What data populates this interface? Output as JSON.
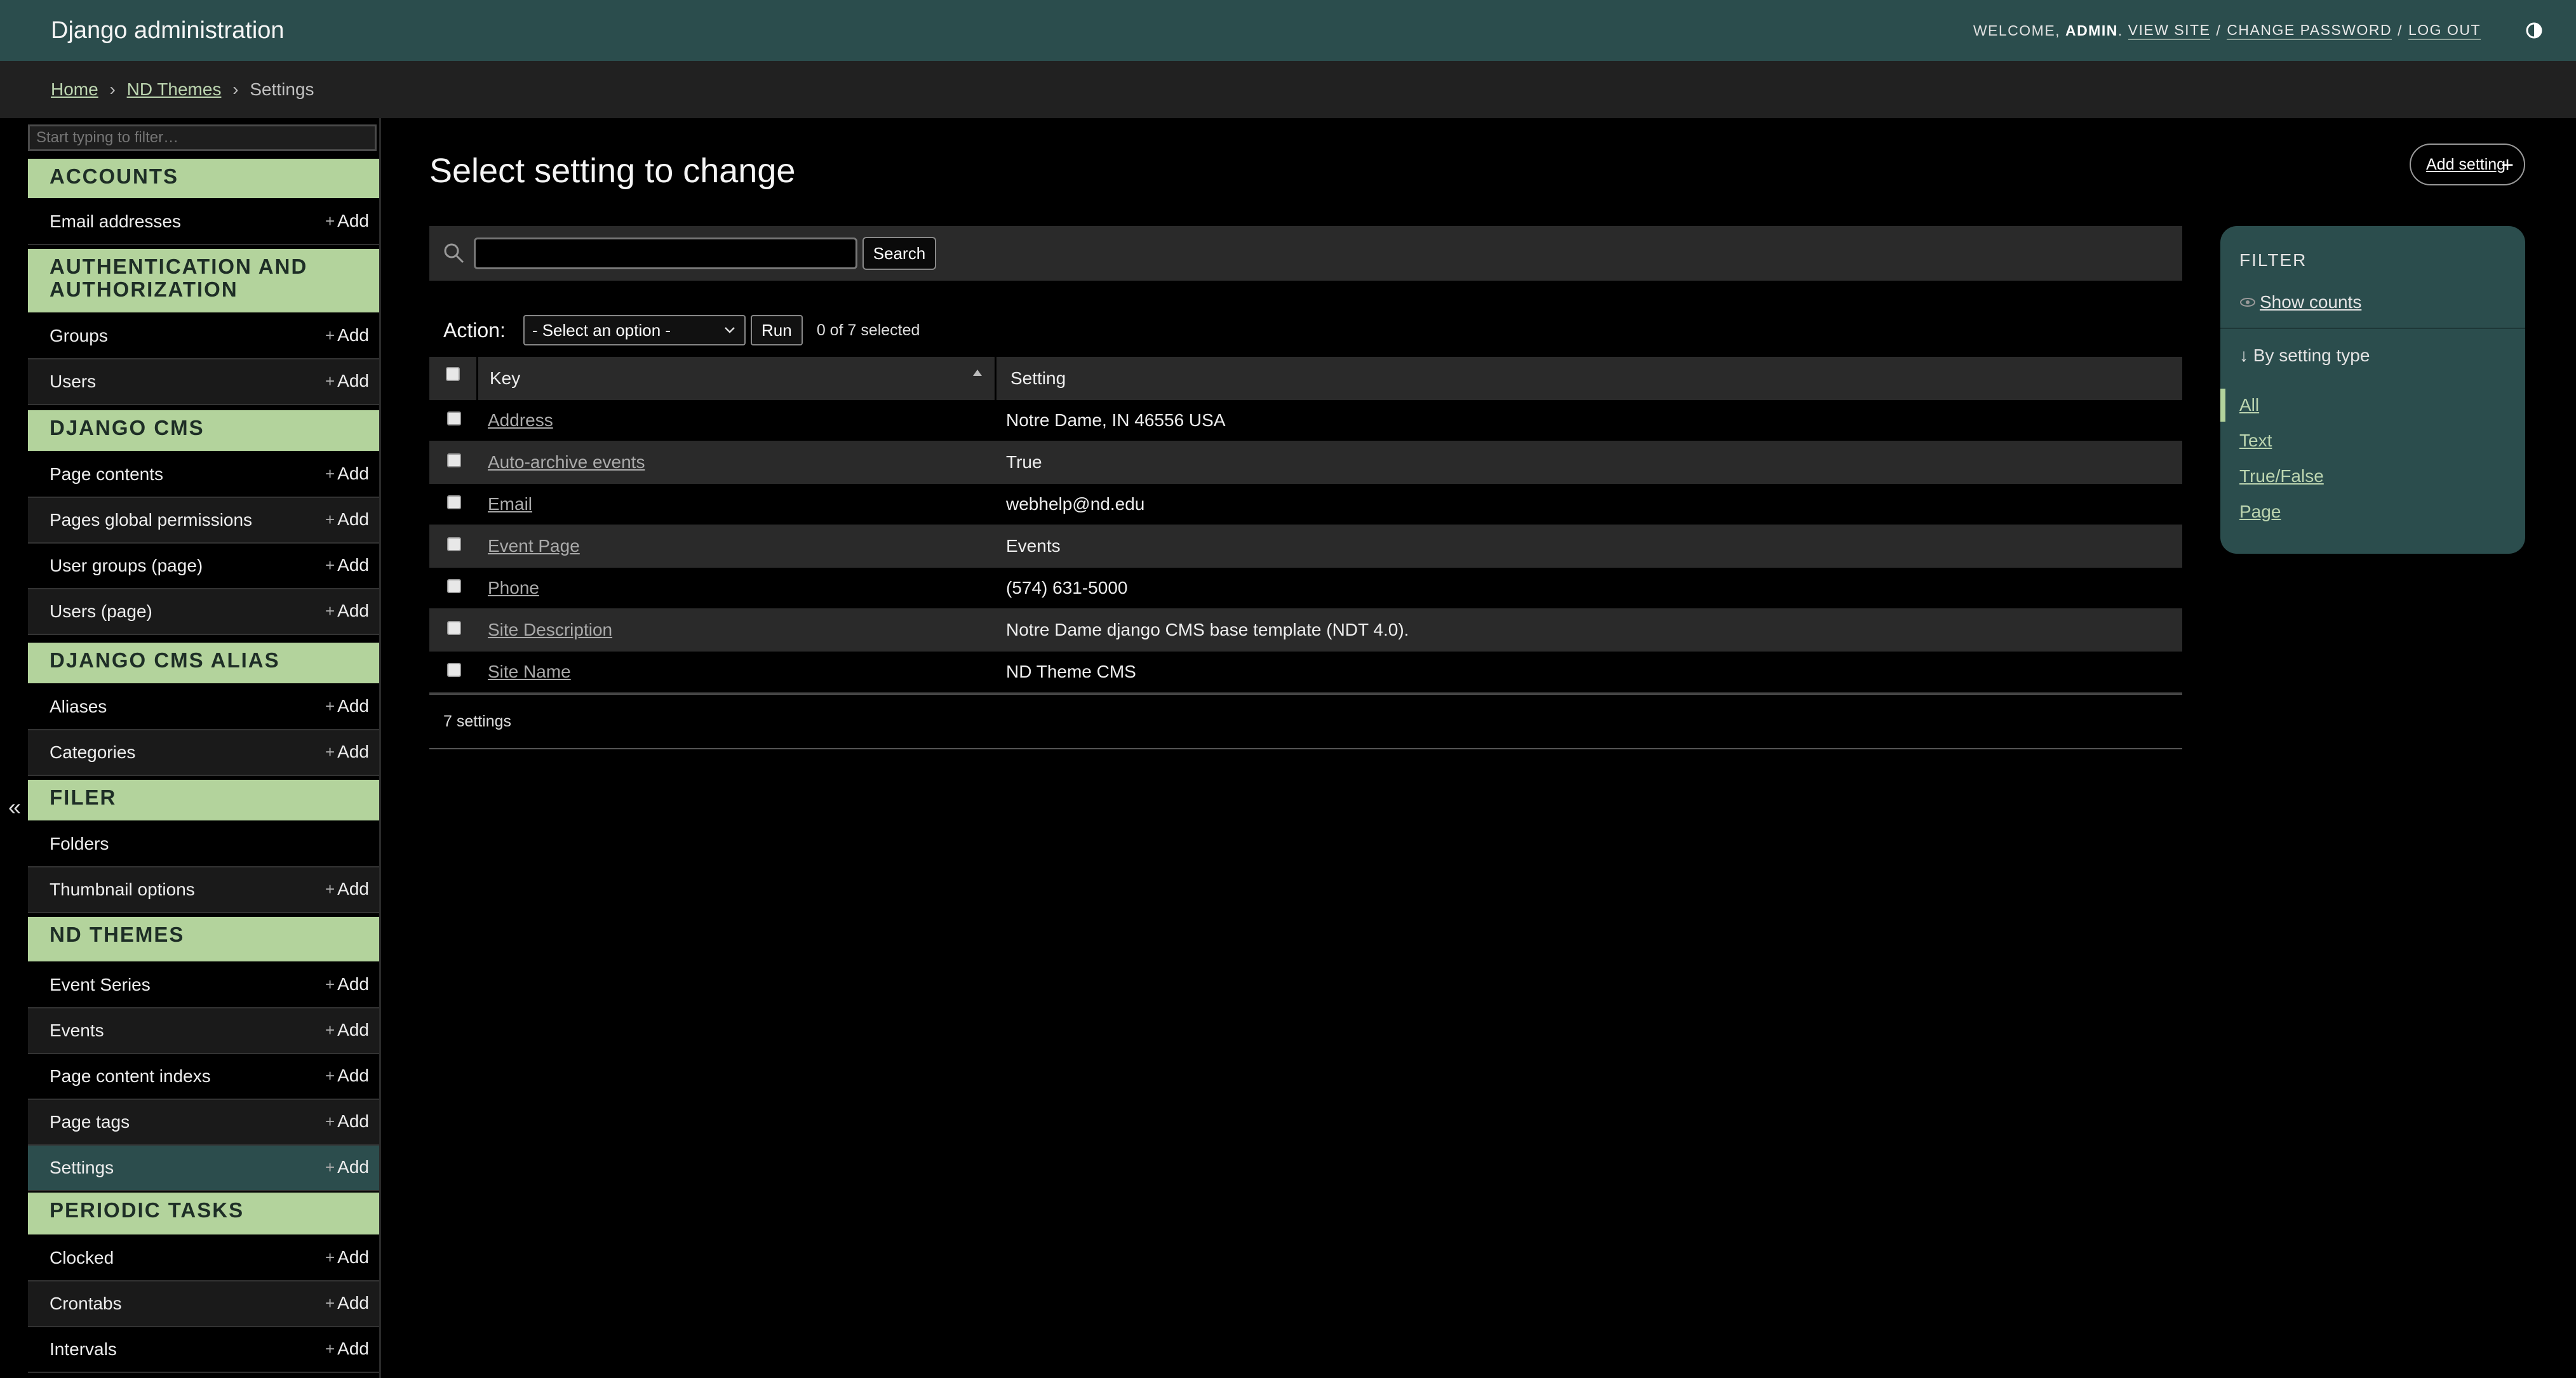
{
  "header": {
    "branding": "Django administration",
    "welcome": "Welcome,",
    "user": "admin",
    "view_site": "View site",
    "change_password": "Change password",
    "log_out": "Log out",
    "sep": "/"
  },
  "breadcrumbs": {
    "home": "Home",
    "app": "ND Themes",
    "current": "Settings",
    "sep": "›"
  },
  "sidebar": {
    "filter_placeholder": "Start typing to filter…",
    "collapse": "«",
    "add_label": "Add",
    "plus": "+",
    "modules": [
      {
        "caption": "Accounts",
        "models": [
          {
            "name": "Email addresses"
          }
        ]
      },
      {
        "caption": "Authentication and Authorization",
        "models": [
          {
            "name": "Groups"
          },
          {
            "name": "Users"
          }
        ]
      },
      {
        "caption": "Django CMS",
        "models": [
          {
            "name": "Page contents"
          },
          {
            "name": "Pages global permissions"
          },
          {
            "name": "User groups (page)"
          },
          {
            "name": "Users (page)"
          }
        ]
      },
      {
        "caption": "Django CMS Alias",
        "models": [
          {
            "name": "Aliases"
          },
          {
            "name": "Categories"
          }
        ]
      },
      {
        "caption": "Filer",
        "models": [
          {
            "name": "Folders"
          },
          {
            "name": "Thumbnail options"
          }
        ]
      },
      {
        "caption": "ND Themes",
        "models": [
          {
            "name": "Event Series"
          },
          {
            "name": "Events"
          },
          {
            "name": "Page content indexs"
          },
          {
            "name": "Page tags"
          },
          {
            "name": "Settings"
          }
        ]
      },
      {
        "caption": "Periodic Tasks",
        "models": [
          {
            "name": "Clocked"
          },
          {
            "name": "Crontabs"
          },
          {
            "name": "Intervals"
          }
        ]
      }
    ]
  },
  "content": {
    "title": "Select setting to change",
    "add_button": "Add setting",
    "search_button": "Search",
    "search_value": "",
    "action_label": "Action:",
    "action_select": "- Select an option -",
    "run_button": "Run",
    "counter": "0 of 7 selected",
    "columns": [
      "Key",
      "Setting"
    ],
    "rows": [
      {
        "key": "Address",
        "setting": "Notre Dame, IN 46556 USA"
      },
      {
        "key": "Auto-archive events",
        "setting": "True"
      },
      {
        "key": "Email",
        "setting": "webhelp@nd.edu"
      },
      {
        "key": "Event Page",
        "setting": "Events"
      },
      {
        "key": "Phone",
        "setting": "(574) 631-5000"
      },
      {
        "key": "Site Description",
        "setting": "Notre Dame django CMS base template (NDT 4.0)."
      },
      {
        "key": "Site Name",
        "setting": "ND Theme CMS"
      }
    ],
    "paginator": "7 settings"
  },
  "filter": {
    "title": "Filter",
    "show_counts": "Show counts",
    "by_label": "By setting type",
    "arrow": "↓",
    "choices": [
      "All",
      "Text",
      "True/False",
      "Page"
    ]
  },
  "colors": {
    "header_bg": "#2b4d4d",
    "module_caption": "#b3d39c",
    "link": "#bcd5b0"
  }
}
